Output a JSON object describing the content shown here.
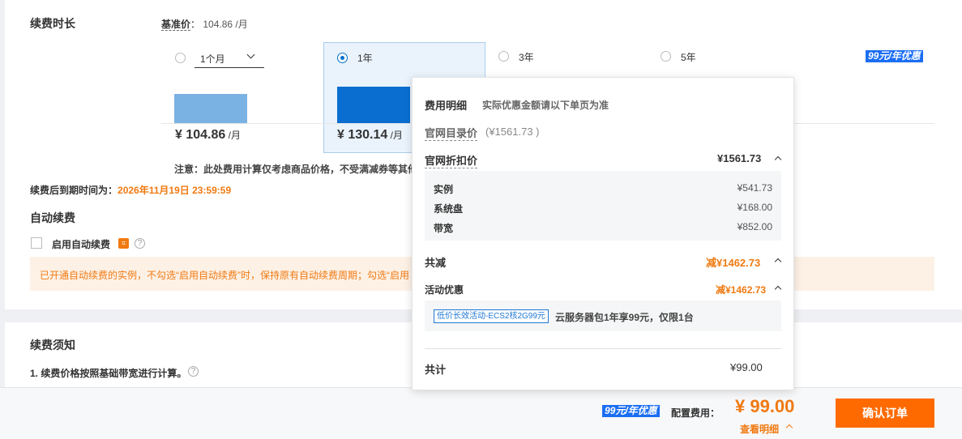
{
  "renewal": {
    "title": "续费时长",
    "base_price_label": "基准价",
    "base_price_sep": "：",
    "base_price_value": "104.86 /月",
    "options": [
      {
        "label": "1个月",
        "selected": false,
        "price": "¥ 104.86",
        "unit": " /月",
        "bar_ratio": 0.8
      },
      {
        "label": "1年",
        "selected": true,
        "price": "¥ 130.14",
        "unit": " /月",
        "bar_ratio": 1.0
      },
      {
        "label": "3年",
        "selected": false
      },
      {
        "label": "5年",
        "selected": false
      }
    ],
    "promo_badge": "99元/年优惠",
    "note": "注意：此处费用计算仅考虑商品价格，不受满减券等其他",
    "expiry_label": "续费后到期时间为：",
    "expiry_value": "2026年11月19日 23:59:59"
  },
  "auto_renew": {
    "title": "自动续费",
    "checkbox_label": "启用自动续费",
    "tag_icon": "discount-tag-icon",
    "help_icon": "question-icon",
    "notice": "已开通自动续费的实例，不勾选“启用自动续费”时，保持原有自动续费周期；勾选“启用"
  },
  "renewal_notes": {
    "title": "续费须知",
    "item1": "1. 续费价格按照基础带宽进行计算。"
  },
  "fee_detail": {
    "title": "费用明细",
    "subtitle": "实际优惠金额请以下单页为准",
    "list_price_label": "官网目录价",
    "list_price_value": "(¥1561.73 )",
    "discount_price_label": "官网折扣价",
    "discount_price_value": "¥1561.73",
    "items": [
      {
        "name": "实例",
        "value": "¥541.73"
      },
      {
        "name": "系统盘",
        "value": "¥168.00"
      },
      {
        "name": "带宽",
        "value": "¥852.00"
      }
    ],
    "total_reduce_label": "共减",
    "total_reduce_value": "减¥1462.73",
    "activity_label": "活动优惠",
    "activity_value": "减¥1462.73",
    "activity_tag": "低价长效活动-ECS2核2G99元",
    "activity_desc": "云服务器包1年享99元，仅限1台",
    "total_label": "共计",
    "total_value": "¥99.00"
  },
  "footer": {
    "promo_badge": "99元/年优惠",
    "fee_label": "配置费用：",
    "fee_value": "¥ 99.00",
    "detail_link": "查看明细",
    "confirm_button": "确认订单"
  },
  "colors": {
    "accent_blue": "#0070cc",
    "bar_light": "#7ab2e4",
    "orange": "#f07a12",
    "button": "#ff6a00"
  }
}
